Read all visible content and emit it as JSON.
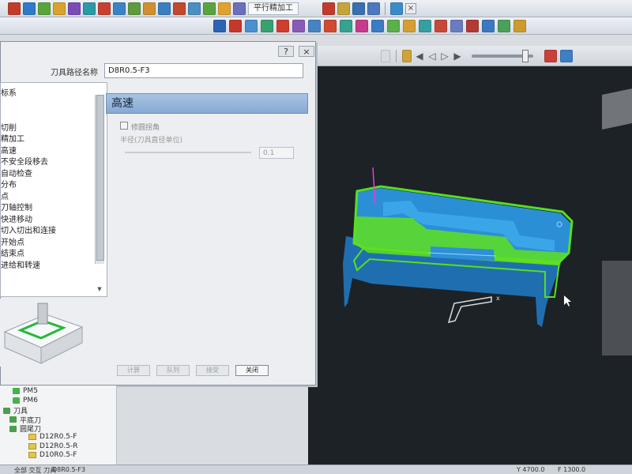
{
  "toolbar": {
    "title_fragment": "平行精加工",
    "row1_icons": [
      "#c23b2a",
      "#2f7bc9",
      "#5aa53a",
      "#d8a22c",
      "#7a4bb8",
      "#2a9aa5",
      "#c7402f",
      "#3b83c7",
      "#5e9b3b",
      "#d09030",
      "#3a7fbf",
      "#c24830",
      "#4b8fc2",
      "#58a540",
      "#e0a22e",
      "#6c6fbb"
    ],
    "row1_right_icons": [
      "#c23b2a",
      "#c4a53c",
      "#3a6fb0",
      "#4a79c0"
    ],
    "row2_icons": [
      "#2d63b5",
      "#c7382c",
      "#4a90d0",
      "#3aa070",
      "#d23c2e",
      "#8a5ab8",
      "#4683c4",
      "#d24a30",
      "#36a38c",
      "#c73a8c",
      "#3c7cc6",
      "#5ab04a",
      "#d5a032",
      "#36a0a0",
      "#c84838",
      "#6a7cc0",
      "#b23a32",
      "#3a78c2",
      "#4ba05a",
      "#cd9b2c"
    ],
    "close_glyph": "×"
  },
  "viewport_toolbar": {
    "glyphs": [
      "◀",
      "◁",
      "▷",
      "▶"
    ]
  },
  "dialog": {
    "help_glyph": "?",
    "close_glyph": "×",
    "name_label": "刀具路径名称",
    "name_value": "D8R0.5-F3",
    "section_title": "高速",
    "option_checkbox_label": "修圆拐角",
    "radius_label": "半径(刀具直径单位)",
    "radius_value": "0.1",
    "buttons": {
      "calc": "计算",
      "queue": "队列",
      "accept": "接受",
      "close": "关闭"
    }
  },
  "tree": {
    "items": [
      "标系",
      "",
      "",
      "切削",
      "精加工",
      "高速",
      "不安全段移去",
      "自动检查",
      "分布",
      "点",
      "刀轴控制",
      "快进移动",
      "切入切出和连接",
      "开始点",
      "结束点",
      "进给和转速"
    ]
  },
  "explorer": {
    "items": [
      {
        "label": "PM5",
        "kind": "toolpath"
      },
      {
        "label": "PM6",
        "kind": "toolpath"
      },
      {
        "label": "刀具",
        "kind": "folder"
      },
      {
        "label": "平底刀",
        "kind": "folder"
      },
      {
        "label": "圆尾刀",
        "kind": "folder"
      },
      {
        "label": "D12R0.5-F",
        "kind": "tool"
      },
      {
        "label": "D12R0.5-R",
        "kind": "tool"
      },
      {
        "label": "D10R0.5-F",
        "kind": "tool"
      }
    ]
  },
  "status": {
    "left": "全部 交互 刀具",
    "toolname": "D8R0.5-F3",
    "y_value": "Y 4700.0",
    "f_value": "F 1300.0"
  },
  "colors": {
    "part_blue": "#2b8fd6",
    "part_dark": "#1d5f9a",
    "toolpath_green": "#56e01e",
    "viewport_bg": "#1d2226",
    "section_header": "#a9c4e4"
  }
}
